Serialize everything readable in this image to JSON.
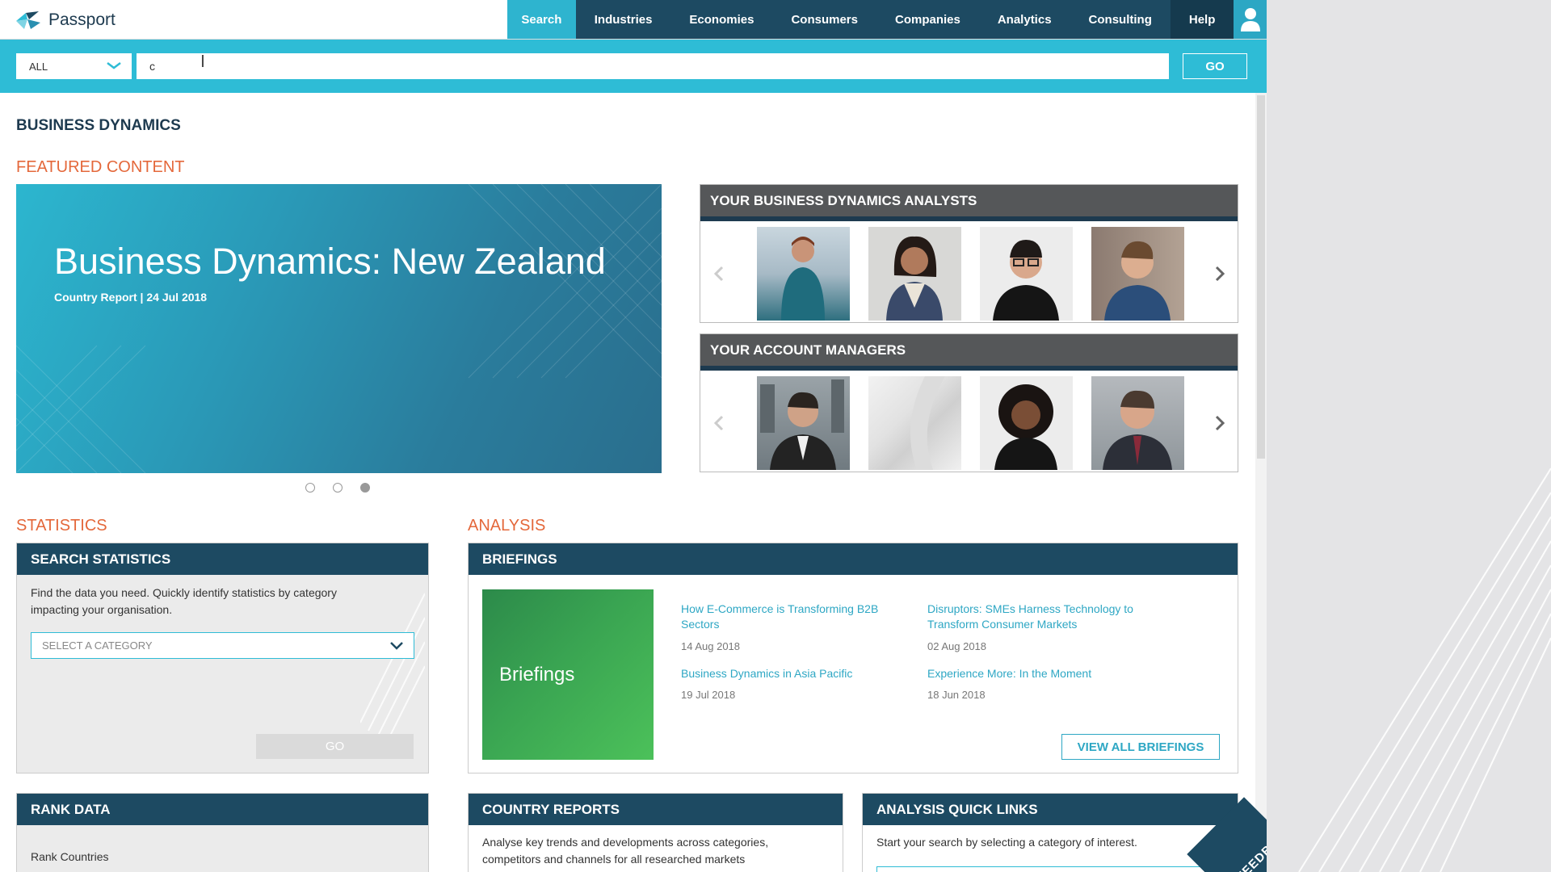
{
  "app": {
    "name": "Passport"
  },
  "nav": {
    "items": [
      "Search",
      "Industries",
      "Economies",
      "Consumers",
      "Companies",
      "Analytics",
      "Consulting",
      "Help"
    ],
    "active": "Search"
  },
  "search": {
    "scope": "ALL",
    "value": "c",
    "go_label": "GO"
  },
  "page": {
    "title": "BUSINESS DYNAMICS",
    "featured_heading": "FEATURED CONTENT",
    "statistics_heading": "STATISTICS",
    "analysis_heading": "ANALYSIS"
  },
  "hero": {
    "title": "Business Dynamics: New Zealand",
    "subtitle": "Country Report | 24 Jul 2018",
    "slides": 3,
    "active_slide": 3
  },
  "analysts": {
    "heading": "YOUR BUSINESS DYNAMICS ANALYSTS"
  },
  "managers": {
    "heading": "YOUR ACCOUNT MANAGERS"
  },
  "search_statistics": {
    "heading": "SEARCH STATISTICS",
    "text": "Find the data you need. Quickly identify statistics by category impacting your organisation.",
    "select_placeholder": "SELECT A CATEGORY",
    "go_label": "GO"
  },
  "briefings": {
    "heading": "BRIEFINGS",
    "tile_label": "Briefings",
    "items": [
      {
        "title": "How E-Commerce is Transforming B2B Sectors",
        "date": "14 Aug 2018"
      },
      {
        "title": "Disruptors: SMEs Harness Technology to Transform Consumer Markets",
        "date": "02 Aug 2018"
      },
      {
        "title": "Business Dynamics in Asia Pacific",
        "date": "19 Jul 2018"
      },
      {
        "title": "Experience More: In the Moment",
        "date": "18 Jun 2018"
      }
    ],
    "view_all_label": "VIEW ALL BRIEFINGS"
  },
  "rank_data": {
    "heading": "RANK DATA",
    "first_item": "Rank Countries"
  },
  "country_reports": {
    "heading": "COUNTRY REPORTS",
    "text": "Analyse key trends and developments across categories, competitors and channels for all researched markets"
  },
  "quick_links": {
    "heading": "ANALYSIS QUICK LINKS",
    "text": "Start your search by selecting a category of interest."
  },
  "feedback": {
    "label": "FEEDBACK"
  },
  "colors": {
    "accent": "#2ebcd6",
    "navy": "#1d4a62",
    "orange": "#e4683b",
    "link": "#2ea7c4"
  }
}
